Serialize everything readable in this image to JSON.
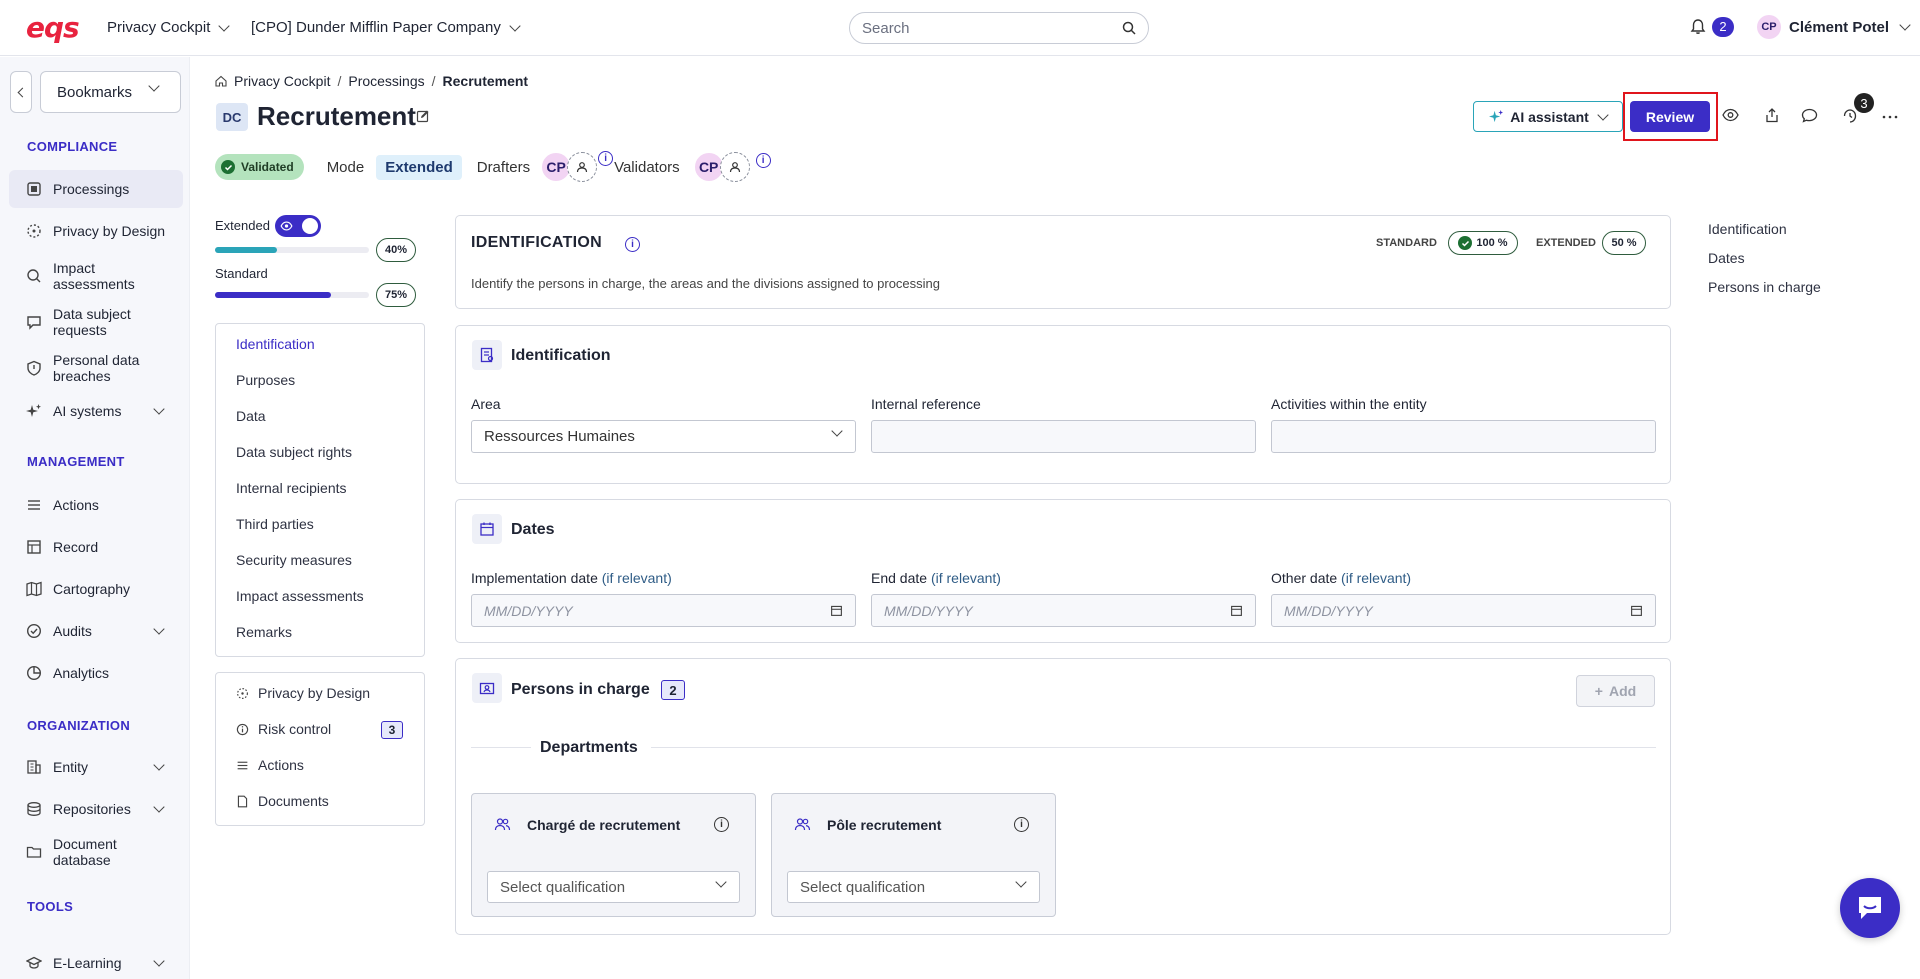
{
  "topbar": {
    "logo": "eqs",
    "app_menu": "Privacy Cockpit",
    "company_menu": "[CPO] Dunder Mifflin Paper Company",
    "search_placeholder": "Search",
    "notifications_count": "2",
    "user_initials": "CP",
    "user_name": "Clément Potel"
  },
  "sidebar": {
    "bookmarks": "Bookmarks",
    "sections": {
      "compliance": "COMPLIANCE",
      "management": "MANAGEMENT",
      "organization": "ORGANIZATION",
      "tools": "TOOLS"
    },
    "items": {
      "processings": "Processings",
      "privacy_by_design": "Privacy by Design",
      "impact_assessments": "Impact assessments",
      "data_subject_requests": "Data subject requests",
      "personal_data_breaches": "Personal data breaches",
      "ai_systems": "AI systems",
      "actions": "Actions",
      "record": "Record",
      "cartography": "Cartography",
      "audits": "Audits",
      "analytics": "Analytics",
      "entity": "Entity",
      "repositories": "Repositories",
      "document_database": "Document database",
      "elearning": "E-Learning"
    }
  },
  "breadcrumb": [
    "Privacy Cockpit",
    "Processings",
    "Recrutement"
  ],
  "header": {
    "badge": "DC",
    "title": "Recrutement",
    "ai_assistant": "AI assistant",
    "review": "Review",
    "history_count": "3"
  },
  "status": {
    "validated": "Validated",
    "mode_label": "Mode",
    "mode_value": "Extended",
    "drafters_label": "Drafters",
    "drafter_initials": "CP",
    "validators_label": "Validators",
    "validator_initials": "CP"
  },
  "progress": {
    "extended_label": "Extended",
    "extended_pct": "40%",
    "extended_value": 0.4,
    "standard_label": "Standard",
    "standard_pct": "75%",
    "standard_value": 0.75
  },
  "section_nav": [
    "Identification",
    "Purposes",
    "Data",
    "Data subject rights",
    "Internal recipients",
    "Third parties",
    "Security measures",
    "Impact assessments",
    "Remarks"
  ],
  "sub_nav": {
    "privacy_by_design": "Privacy by Design",
    "risk_control": "Risk control",
    "risk_count": "3",
    "actions": "Actions",
    "documents": "Documents"
  },
  "identification_header": {
    "title": "IDENTIFICATION",
    "description": "Identify the persons in charge, the areas and the divisions assigned to processing",
    "standard_label": "STANDARD",
    "standard_pct": "100 %",
    "extended_label": "EXTENDED",
    "extended_pct": "50 %"
  },
  "identification_card": {
    "title": "Identification",
    "area_label": "Area",
    "area_value": "Ressources Humaines",
    "internal_ref_label": "Internal reference",
    "activities_label": "Activities within the entity"
  },
  "dates_card": {
    "title": "Dates",
    "impl_label": "Implementation date",
    "end_label": "End date",
    "other_label": "Other date",
    "hint": "(if relevant)",
    "placeholder": "MM/DD/YYYY"
  },
  "persons_card": {
    "title": "Persons in charge",
    "count": "2",
    "add": "Add",
    "departments": "Departments",
    "dept1": "Chargé de recrutement",
    "dept2": "Pôle recrutement",
    "select_placeholder": "Select qualification"
  },
  "toc": [
    "Identification",
    "Dates",
    "Persons in charge"
  ],
  "colors": {
    "primary": "#3b2dc6",
    "brand": "#e8233f",
    "validated": "#b4e3bd",
    "highlight": "#e0151c"
  }
}
